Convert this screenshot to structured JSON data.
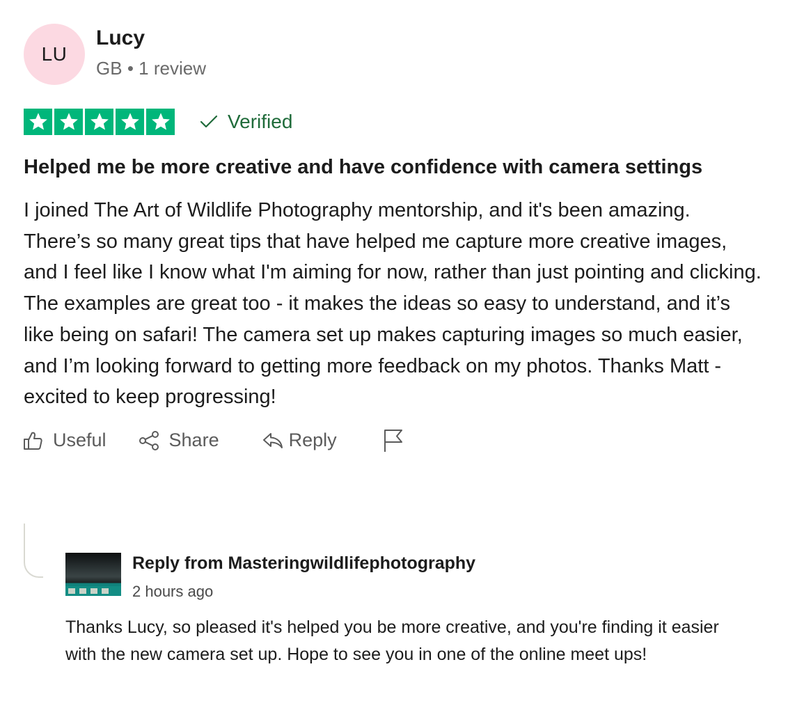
{
  "review": {
    "consumer": {
      "initials": "LU",
      "name": "Lucy",
      "country": "GB",
      "separator": "•",
      "review_count": "1 review"
    },
    "rating": 5,
    "max_rating": 5,
    "verified_label": "Verified",
    "title": "Helped me be more creative and have confidence with camera settings",
    "text": "I joined The Art of Wildlife Photography mentorship, and it's been amazing. There’s so many great tips that have helped me capture more creative images, and I feel like I know what I'm aiming for now, rather than just pointing and clicking. The examples are great too - it makes the ideas so easy to understand, and it’s like being on safari! The camera set up makes capturing images so much easier, and I’m looking forward to getting more feedback on my photos. Thanks Matt - excited to keep progressing!",
    "actions": {
      "useful_label": "Useful",
      "share_label": "Share",
      "reply_label": "Reply"
    }
  },
  "company_reply": {
    "from_label": "Reply from Masteringwildlifephotography",
    "date": "2 hours ago",
    "text": "Thanks Lucy, so pleased it's helped you be more creative, and you're finding it easier with the new camera set up. Hope to see you in one of the online meet ups!"
  },
  "colors": {
    "star_green": "#00b67a",
    "verified_green": "#1f6b3a",
    "avatar_pink": "#fcd9e2"
  },
  "icons": {
    "star": "star-icon",
    "verified": "checkmark-icon",
    "useful": "thumbs-up-icon",
    "share": "share-icon",
    "reply": "reply-arrow-icon",
    "report": "flag-icon"
  }
}
